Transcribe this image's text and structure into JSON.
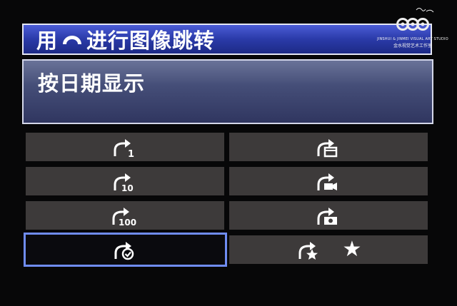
{
  "title": {
    "text_before": "用",
    "dial_icon": "main-dial-icon",
    "text_after": "进行图像跳转"
  },
  "watermark": {
    "logo": "studio-logo",
    "line1": "JINSHUI & JINMEI VISUAL ART STUDIO",
    "line2": "金水视觉艺术工作室"
  },
  "current_setting": {
    "label": "按日期显示"
  },
  "options": [
    {
      "id": "1-image",
      "icon": "jump-1-image-icon",
      "number": "1",
      "selected": false
    },
    {
      "id": "date",
      "icon": "jump-date-icon",
      "selected": false
    },
    {
      "id": "10-images",
      "icon": "jump-10-images-icon",
      "number": "10",
      "selected": false
    },
    {
      "id": "movies",
      "icon": "jump-movies-icon",
      "selected": false
    },
    {
      "id": "100-images",
      "icon": "jump-100-images-icon",
      "number": "100",
      "selected": false
    },
    {
      "id": "stills",
      "icon": "jump-stills-icon",
      "selected": false
    },
    {
      "id": "protected",
      "icon": "jump-protected-icon",
      "selected": true
    },
    {
      "id": "rating",
      "icon": "jump-rating-icon",
      "extra": "★",
      "selected": false
    }
  ],
  "colors": {
    "title_bg": "#2a3aa8",
    "selection_border": "#6f8cf2",
    "option_bg": "#3d3a3a",
    "info_bg": "#454e78"
  }
}
